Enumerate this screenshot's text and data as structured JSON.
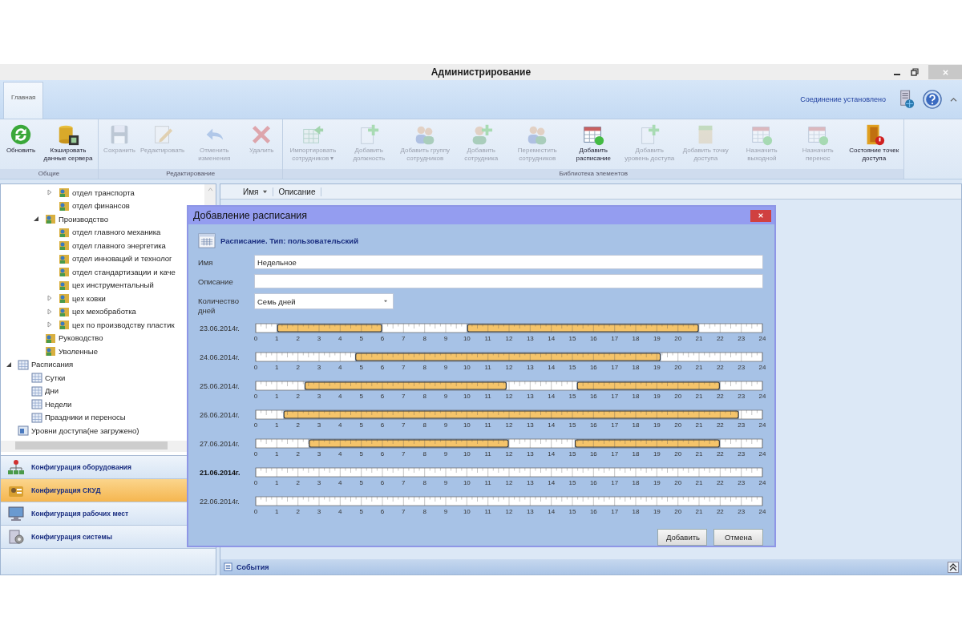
{
  "window": {
    "title": "Администрирование"
  },
  "ribbon": {
    "tabs": [
      {
        "label": "Главная",
        "selected": true
      }
    ],
    "connection_status": "Соединение установлено",
    "groups": [
      {
        "label": "Общие",
        "buttons": [
          {
            "label": "Обновить",
            "disabled": false
          },
          {
            "label": "Кэшировать данные сервера",
            "disabled": false
          }
        ]
      },
      {
        "label": "Редактирование",
        "buttons": [
          {
            "label": "Сохранить",
            "disabled": true
          },
          {
            "label": "Редактировать",
            "disabled": true
          },
          {
            "label": "Отменить изменения",
            "disabled": true
          },
          {
            "label": "Удалить",
            "disabled": true
          }
        ]
      },
      {
        "label": "Библиотека элементов",
        "buttons": [
          {
            "label": "Импортировать сотрудников ▾",
            "disabled": true
          },
          {
            "label": "Добавить должность",
            "disabled": true
          },
          {
            "label": "Добавить группу сотрудников",
            "disabled": true
          },
          {
            "label": "Добавить сотрудника",
            "disabled": true
          },
          {
            "label": "Переместить сотрудников",
            "disabled": true
          },
          {
            "label": "Добавить расписание",
            "disabled": false
          },
          {
            "label": "Добавить уровень доступа",
            "disabled": true
          },
          {
            "label": "Добавить точку доступа",
            "disabled": true
          },
          {
            "label": "Назначить выходной",
            "disabled": true
          },
          {
            "label": "Назначить перенос",
            "disabled": true
          },
          {
            "label": "Состояние точек доступа",
            "disabled": false
          }
        ]
      }
    ]
  },
  "tree": [
    {
      "children": [
        {
          "children": [
            {
              "children": [
                {
                  "label": "отдел транспорта",
                  "kind": "department",
                  "expanded": false
                },
                {
                  "label": "отдел финансов",
                  "kind": "department"
                }
              ]
            },
            {
              "label": "Производство",
              "kind": "department",
              "expanded": true,
              "children": [
                {
                  "label": "отдел главного механика",
                  "kind": "department"
                },
                {
                  "label": "отдел главного энергетика",
                  "kind": "department"
                },
                {
                  "label": "отдел инноваций и технолог",
                  "kind": "department"
                },
                {
                  "label": "отдел стандартизации и каче",
                  "kind": "department"
                },
                {
                  "label": "цех инструментальный",
                  "kind": "department"
                },
                {
                  "label": "цех ковки",
                  "kind": "department",
                  "expanded": false
                },
                {
                  "label": "цех мехобработка",
                  "kind": "department",
                  "expanded": false
                },
                {
                  "label": "цех по производству пластик",
                  "kind": "department",
                  "expanded": false
                }
              ]
            },
            {
              "label": "Руководство",
              "kind": "department"
            },
            {
              "label": "Уволенные",
              "kind": "department"
            }
          ]
        }
      ]
    },
    {
      "label": "Расписания",
      "kind": "schedules",
      "expanded": true,
      "children": [
        {
          "label": "Сутки",
          "kind": "schedule"
        },
        {
          "label": "Дни",
          "kind": "schedule"
        },
        {
          "label": "Недели",
          "kind": "schedule"
        },
        {
          "label": "Праздники и переносы",
          "kind": "schedule"
        }
      ]
    },
    {
      "label": "Уровни доступа(не загружено)",
      "kind": "access"
    }
  ],
  "nav": [
    {
      "label": "Конфигурация оборудования",
      "selected": false
    },
    {
      "label": "Конфигурация СКУД",
      "selected": true
    },
    {
      "label": "Конфигурация рабочих мест",
      "selected": false
    },
    {
      "label": "Конфигурация системы",
      "selected": false
    }
  ],
  "grid": {
    "columns": [
      {
        "label": "Имя",
        "filter": true
      },
      {
        "label": "Описание",
        "filter": false
      }
    ]
  },
  "events_bar": {
    "label": "События"
  },
  "dialog": {
    "title": "Добавление расписания",
    "heading": "Расписание. Тип: пользовательский",
    "fields": [
      {
        "label": "Имя",
        "kind": "text",
        "value": "Недельное"
      },
      {
        "label": "Описание",
        "kind": "text"
      },
      {
        "label": "Количество дней",
        "kind": "dropdown",
        "value": "Семь дней"
      }
    ],
    "timelines": [
      {
        "emphasized": false,
        "chart_data": {
          "type": "bar",
          "orientation": "horizontal",
          "stacked": true,
          "categories": [
            "23.06.2014г."
          ],
          "xlim": [
            0,
            24
          ],
          "xticks": [
            0,
            1,
            2,
            3,
            4,
            5,
            6,
            7,
            8,
            9,
            10,
            11,
            12,
            13,
            14,
            15,
            16,
            17,
            18,
            19,
            20,
            21,
            22,
            23,
            24
          ],
          "series": [
            {
              "color": "#ffffff",
              "values": [
                1
              ]
            },
            {
              "color": "#f5c46a",
              "values": [
                5
              ]
            },
            {
              "color": "#ffffff",
              "values": [
                4
              ]
            },
            {
              "color": "#f5c46a",
              "values": [
                11
              ]
            },
            {
              "color": "#ffffff",
              "values": [
                3
              ]
            }
          ]
        }
      },
      {
        "emphasized": false,
        "chart_data": {
          "type": "bar",
          "orientation": "horizontal",
          "stacked": true,
          "categories": [
            "24.06.2014г."
          ],
          "xlim": [
            0,
            24
          ],
          "xticks": [
            0,
            1,
            2,
            3,
            4,
            5,
            6,
            7,
            8,
            9,
            10,
            11,
            12,
            13,
            14,
            15,
            16,
            17,
            18,
            19,
            20,
            21,
            22,
            23,
            24
          ],
          "series": [
            {
              "color": "#ffffff",
              "values": [
                4.7
              ]
            },
            {
              "color": "#f5c46a",
              "values": [
                14.5
              ]
            },
            {
              "color": "#ffffff",
              "values": [
                4.8
              ]
            }
          ]
        }
      },
      {
        "emphasized": false,
        "chart_data": {
          "type": "bar",
          "orientation": "horizontal",
          "stacked": true,
          "categories": [
            "25.06.2014г."
          ],
          "xlim": [
            0,
            24
          ],
          "xticks": [
            0,
            1,
            2,
            3,
            4,
            5,
            6,
            7,
            8,
            9,
            10,
            11,
            12,
            13,
            14,
            15,
            16,
            17,
            18,
            19,
            20,
            21,
            22,
            23,
            24
          ],
          "series": [
            {
              "color": "#ffffff",
              "values": [
                2.3
              ]
            },
            {
              "color": "#f5c46a",
              "values": [
                9.6
              ]
            },
            {
              "color": "#ffffff",
              "values": [
                3.3
              ]
            },
            {
              "color": "#f5c46a",
              "values": [
                6.8
              ]
            },
            {
              "color": "#ffffff",
              "values": [
                2
              ]
            }
          ]
        }
      },
      {
        "emphasized": false,
        "chart_data": {
          "type": "bar",
          "orientation": "horizontal",
          "stacked": true,
          "categories": [
            "26.06.2014г."
          ],
          "xlim": [
            0,
            24
          ],
          "xticks": [
            0,
            1,
            2,
            3,
            4,
            5,
            6,
            7,
            8,
            9,
            10,
            11,
            12,
            13,
            14,
            15,
            16,
            17,
            18,
            19,
            20,
            21,
            22,
            23,
            24
          ],
          "series": [
            {
              "color": "#ffffff",
              "values": [
                1.3
              ]
            },
            {
              "color": "#f5c46a",
              "values": [
                21.6
              ]
            },
            {
              "color": "#ffffff",
              "values": [
                1.1
              ]
            }
          ]
        }
      },
      {
        "emphasized": false,
        "chart_data": {
          "type": "bar",
          "orientation": "horizontal",
          "stacked": true,
          "categories": [
            "27.06.2014г."
          ],
          "xlim": [
            0,
            24
          ],
          "xticks": [
            0,
            1,
            2,
            3,
            4,
            5,
            6,
            7,
            8,
            9,
            10,
            11,
            12,
            13,
            14,
            15,
            16,
            17,
            18,
            19,
            20,
            21,
            22,
            23,
            24
          ],
          "series": [
            {
              "color": "#ffffff",
              "values": [
                2.5
              ]
            },
            {
              "color": "#f5c46a",
              "values": [
                9.5
              ]
            },
            {
              "color": "#ffffff",
              "values": [
                3.1
              ]
            },
            {
              "color": "#f5c46a",
              "values": [
                6.9
              ]
            },
            {
              "color": "#ffffff",
              "values": [
                2
              ]
            }
          ]
        }
      },
      {
        "emphasized": true,
        "chart_data": {
          "type": "bar",
          "orientation": "horizontal",
          "stacked": true,
          "categories": [
            "21.06.2014г."
          ],
          "xlim": [
            0,
            24
          ],
          "xticks": [
            0,
            1,
            2,
            3,
            4,
            5,
            6,
            7,
            8,
            9,
            10,
            11,
            12,
            13,
            14,
            15,
            16,
            17,
            18,
            19,
            20,
            21,
            22,
            23,
            24
          ],
          "series": [
            {
              "color": "#ffffff",
              "values": [
                24
              ]
            }
          ]
        }
      },
      {
        "emphasized": false,
        "chart_data": {
          "type": "bar",
          "orientation": "horizontal",
          "stacked": true,
          "categories": [
            "22.06.2014г."
          ],
          "xlim": [
            0,
            24
          ],
          "xticks": [
            0,
            1,
            2,
            3,
            4,
            5,
            6,
            7,
            8,
            9,
            10,
            11,
            12,
            13,
            14,
            15,
            16,
            17,
            18,
            19,
            20,
            21,
            22,
            23,
            24
          ],
          "series": [
            {
              "color": "#ffffff",
              "values": [
                24
              ]
            }
          ]
        }
      }
    ],
    "buttons": [
      {
        "label": "Добавить"
      },
      {
        "label": "Отмена"
      }
    ]
  }
}
